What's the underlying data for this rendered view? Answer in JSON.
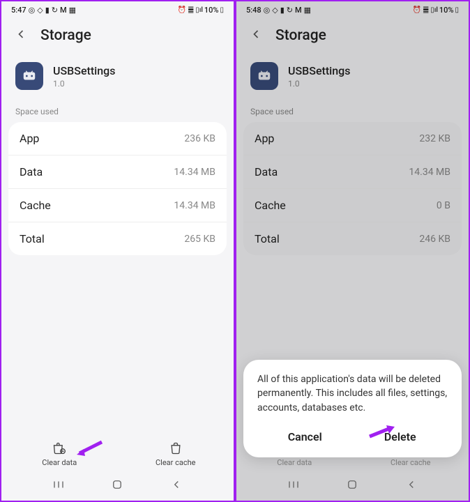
{
  "left": {
    "status": {
      "time": "5:47",
      "battery_pct": "10%"
    },
    "header": {
      "title": "Storage"
    },
    "app": {
      "name": "USBSettings",
      "version": "1.0"
    },
    "section_label": "Space used",
    "rows": {
      "app": {
        "label": "App",
        "value": "236 KB"
      },
      "data": {
        "label": "Data",
        "value": "14.34 MB"
      },
      "cache": {
        "label": "Cache",
        "value": "14.34 MB"
      },
      "total": {
        "label": "Total",
        "value": "265 KB"
      }
    },
    "actions": {
      "clear_data": "Clear data",
      "clear_cache": "Clear cache"
    }
  },
  "right": {
    "status": {
      "time": "5:48",
      "battery_pct": "10%"
    },
    "header": {
      "title": "Storage"
    },
    "app": {
      "name": "USBSettings",
      "version": "1.0"
    },
    "section_label": "Space used",
    "rows": {
      "app": {
        "label": "App",
        "value": "232 KB"
      },
      "data": {
        "label": "Data",
        "value": "14.34 MB"
      },
      "cache": {
        "label": "Cache",
        "value": "0 B"
      },
      "total": {
        "label": "Total",
        "value": "246 KB"
      }
    },
    "actions": {
      "clear_data": "Clear data",
      "clear_cache": "Clear cache"
    },
    "dialog": {
      "text": "All of this application's data will be deleted permanently. This includes all files, settings, accounts, databases etc.",
      "cancel": "Cancel",
      "delete": "Delete"
    }
  }
}
